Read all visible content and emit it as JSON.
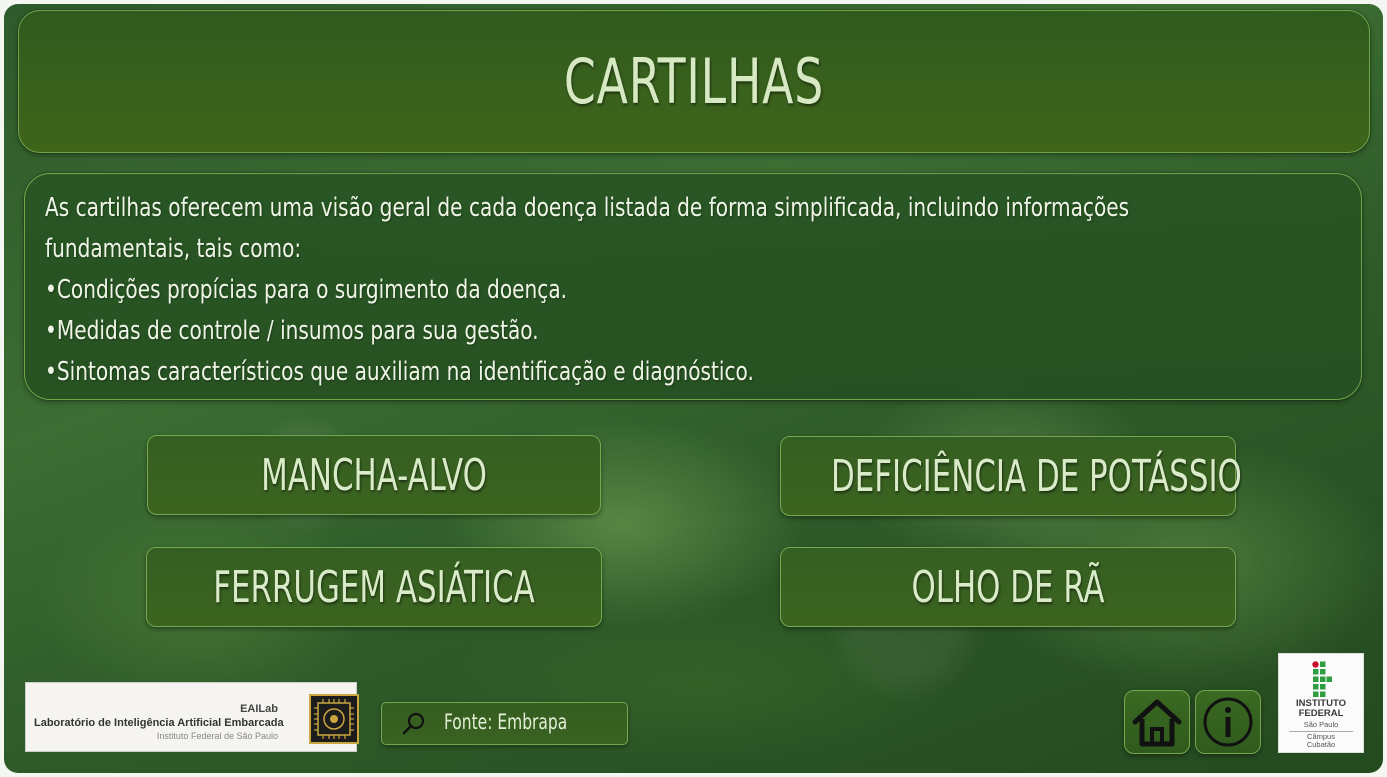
{
  "header": {
    "title": "CARTILHAS"
  },
  "description": {
    "lines": [
      "As cartilhas oferecem uma visão geral de cada doença listada de forma simplificada, incluindo informações",
      "fundamentais, tais como:",
      "•Condições propícias para o surgimento da doença.",
      "•Medidas de controle / insumos para sua gestão.",
      "•Sintomas característicos que auxiliam na identificação e diagnóstico."
    ]
  },
  "buttons": [
    {
      "label": "MANCHA-ALVO"
    },
    {
      "label": "DEFICIÊNCIA DE POTÁSSIO"
    },
    {
      "label": "FERRUGEM ASIÁTICA"
    },
    {
      "label": "OLHO DE RÃ"
    }
  ],
  "footer": {
    "source_label": "Fonte: Embrapa",
    "lab_logo": {
      "short": "EAILab",
      "name": "Laboratório de Inteligência Artificial Embarcada",
      "institution": "Instituto Federal de São Paulo"
    },
    "if_logo": {
      "line1": "INSTITUTO",
      "line2": "FEDERAL",
      "line3": "São Paulo",
      "line4": "Câmpus",
      "line5": "Cubatão"
    }
  },
  "icons": [
    "search-icon",
    "home-icon",
    "info-icon"
  ],
  "colors": {
    "panel": "#355f22",
    "border": "#73a84f",
    "title_text": "#d6e9c2"
  }
}
